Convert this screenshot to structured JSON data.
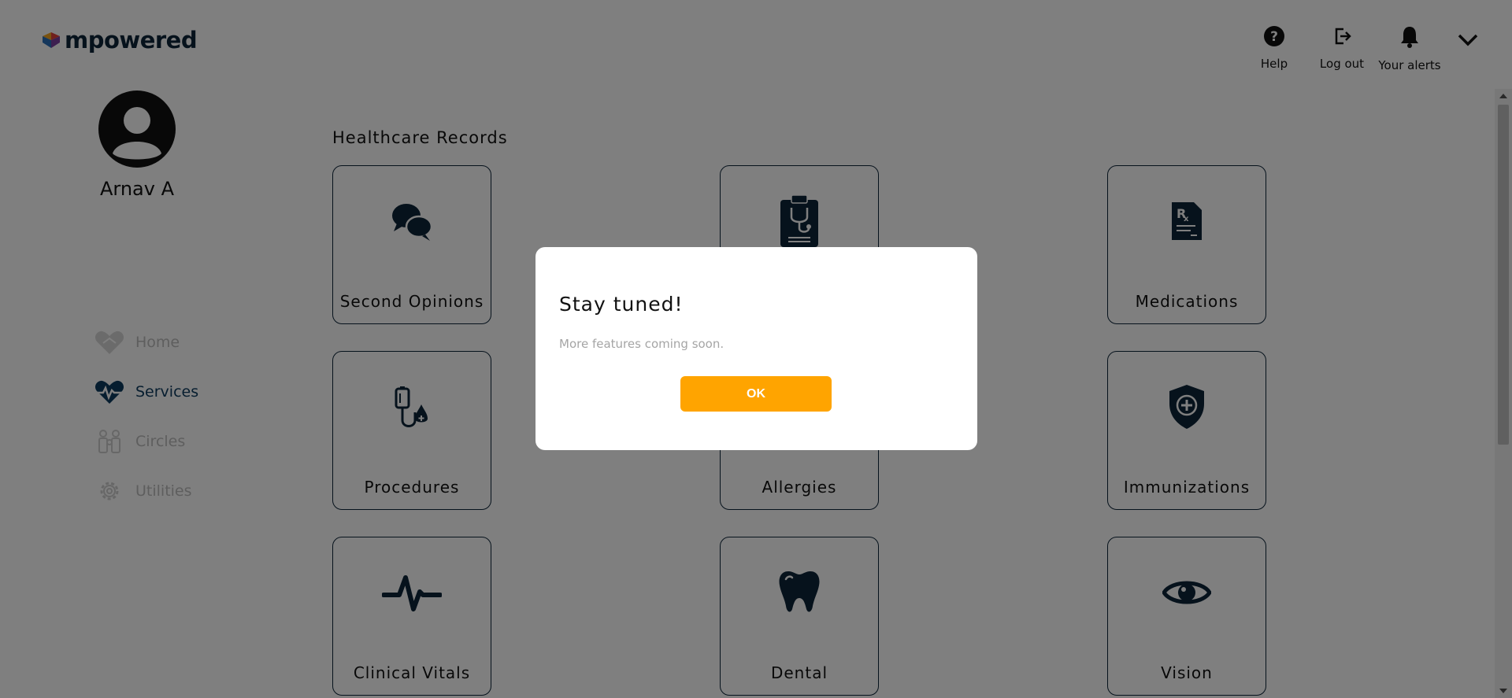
{
  "header": {
    "logo_text": "mpowered",
    "actions": [
      {
        "label": "Help",
        "icon": "help-icon"
      },
      {
        "label": "Log out",
        "icon": "logout-icon"
      },
      {
        "label": "Your alerts",
        "icon": "bell-icon"
      }
    ],
    "menu_icon": "chevron-down-icon"
  },
  "sidebar": {
    "user_name": "Arnav A",
    "nav": [
      {
        "label": "Home",
        "icon": "home-heart-icon",
        "active": false
      },
      {
        "label": "Services",
        "icon": "heartbeat-icon",
        "active": true
      },
      {
        "label": "Circles",
        "icon": "people-icon",
        "active": false
      },
      {
        "label": "Utilities",
        "icon": "gear-icon",
        "active": false
      }
    ]
  },
  "main": {
    "section_title": "Healthcare Records",
    "cards": [
      {
        "label": "Second Opinions",
        "icon": "chat-bubbles-icon"
      },
      {
        "label": "",
        "icon": "clipboard-stethoscope-icon"
      },
      {
        "label": "Medications",
        "icon": "prescription-icon"
      },
      {
        "label": "Procedures",
        "icon": "iv-drip-icon"
      },
      {
        "label": "Allergies",
        "icon": "allergy-icon"
      },
      {
        "label": "Immunizations",
        "icon": "shield-plus-icon"
      },
      {
        "label": "Clinical Vitals",
        "icon": "pulse-icon"
      },
      {
        "label": "Dental",
        "icon": "tooth-icon"
      },
      {
        "label": "Vision",
        "icon": "eye-icon"
      }
    ]
  },
  "modal": {
    "title": "Stay tuned!",
    "message": "More features coming soon.",
    "ok_label": "OK"
  },
  "colors": {
    "navy": "#0d2438",
    "accent": "#ffa400",
    "overlay": "rgba(0,0,0,0.5)"
  }
}
